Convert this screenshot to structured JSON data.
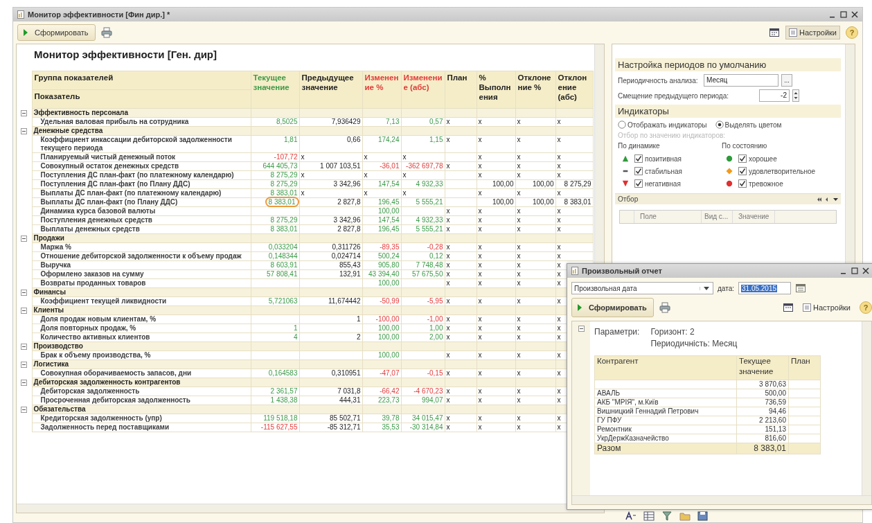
{
  "window": {
    "title": "Монитор эффективности [Фин дир.] *"
  },
  "toolbar": {
    "generate_button": "Сформировать",
    "settings_button": "Настройки",
    "help": "?"
  },
  "report": {
    "title": "Монитор эффективности [Ген. дир]",
    "name_headers": [
      "Группа показателей",
      "Показатель"
    ],
    "columns": [
      {
        "label": "Текущее значение",
        "kind": "positive"
      },
      {
        "label": "Предыдущее значение",
        "kind": "plain"
      },
      {
        "label": "Изменение %",
        "kind": "negative"
      },
      {
        "label": "Изменение (абс)",
        "kind": "negative"
      },
      {
        "label": "План",
        "kind": "plain"
      },
      {
        "label": "% Выполнения",
        "kind": "plain"
      },
      {
        "label": "Отклонение %",
        "kind": "plain"
      },
      {
        "label": "Отклонение (абс)",
        "kind": "plain"
      }
    ],
    "groups": [
      {
        "name": "Эффективность персонала",
        "expanded": true,
        "rows": [
          {
            "name": "Удельная валовая прибыль на сотрудника",
            "cells": [
              {
                "text": "8,5025",
                "kind": "positive"
              },
              {
                "text": "7,936429",
                "kind": "plain"
              },
              {
                "text": "7,13",
                "kind": "positive"
              },
              {
                "text": "0,57",
                "kind": "positive"
              },
              {
                "text": "x",
                "kind": "mark"
              },
              {
                "text": "x",
                "kind": "mark"
              },
              {
                "text": "x",
                "kind": "mark"
              },
              {
                "text": "x",
                "kind": "mark"
              }
            ]
          }
        ]
      },
      {
        "name": "Денежные средства",
        "expanded": true,
        "rows": [
          {
            "name": "Коэффициент инкассации дебиторской задолженности текущего периода",
            "cells": [
              {
                "text": "1,81",
                "kind": "positive"
              },
              {
                "text": "0,66",
                "kind": "plain"
              },
              {
                "text": "174,24",
                "kind": "positive"
              },
              {
                "text": "1,15",
                "kind": "positive"
              },
              {
                "text": "x",
                "kind": "mark"
              },
              {
                "text": "x",
                "kind": "mark"
              },
              {
                "text": "x",
                "kind": "mark"
              },
              {
                "text": "x",
                "kind": "mark"
              }
            ]
          },
          {
            "name": "Планируемый чистый денежный поток",
            "cells": [
              {
                "text": "-107,72",
                "kind": "negative"
              },
              {
                "text": "x",
                "kind": "mark"
              },
              {
                "text": "x",
                "kind": "mark"
              },
              {
                "text": "x",
                "kind": "mark"
              },
              null,
              {
                "text": "x",
                "kind": "mark"
              },
              {
                "text": "x",
                "kind": "mark"
              },
              {
                "text": "x",
                "kind": "mark"
              }
            ]
          },
          {
            "name": "Совокупный остаток денежных средств",
            "cells": [
              {
                "text": "644 405,73",
                "kind": "positive"
              },
              {
                "text": "1 007 103,51",
                "kind": "plain"
              },
              {
                "text": "-36,01",
                "kind": "negative"
              },
              {
                "text": "-362 697,78",
                "kind": "negative"
              },
              {
                "text": "x",
                "kind": "mark"
              },
              {
                "text": "x",
                "kind": "mark"
              },
              {
                "text": "x",
                "kind": "mark"
              },
              {
                "text": "x",
                "kind": "mark"
              }
            ]
          },
          {
            "name": "Поступления ДС план-факт (по платежному календарю)",
            "cells": [
              {
                "text": "8 275,29",
                "kind": "positive"
              },
              {
                "text": "x",
                "kind": "mark"
              },
              {
                "text": "x",
                "kind": "mark"
              },
              {
                "text": "x",
                "kind": "mark"
              },
              null,
              {
                "text": "x",
                "kind": "mark"
              },
              {
                "text": "x",
                "kind": "mark"
              },
              {
                "text": "x",
                "kind": "mark"
              }
            ]
          },
          {
            "name": "Поступления ДС план-факт (по Плану ДДС)",
            "cells": [
              {
                "text": "8 275,29",
                "kind": "positive"
              },
              {
                "text": "3 342,96",
                "kind": "plain"
              },
              {
                "text": "147,54",
                "kind": "positive"
              },
              {
                "text": "4 932,33",
                "kind": "positive"
              },
              null,
              {
                "text": "100,00",
                "kind": "plain"
              },
              {
                "text": "100,00",
                "kind": "plain"
              },
              {
                "text": "8 275,29",
                "kind": "plain"
              }
            ]
          },
          {
            "name": "Выплаты ДС план-факт (по платежному календарю)",
            "cells": [
              {
                "text": "8 383,01",
                "kind": "positive"
              },
              {
                "text": "x",
                "kind": "mark"
              },
              {
                "text": "x",
                "kind": "mark"
              },
              {
                "text": "x",
                "kind": "mark"
              },
              null,
              {
                "text": "x",
                "kind": "mark"
              },
              {
                "text": "x",
                "kind": "mark"
              },
              {
                "text": "x",
                "kind": "mark"
              }
            ]
          },
          {
            "name": "Выплаты ДС план-факт (по Плану ДДС)",
            "cells": [
              {
                "text": "8 383,01",
                "kind": "positive",
                "circled": true
              },
              {
                "text": "2 827,8",
                "kind": "plain"
              },
              {
                "text": "196,45",
                "kind": "positive"
              },
              {
                "text": "5 555,21",
                "kind": "positive"
              },
              null,
              {
                "text": "100,00",
                "kind": "plain"
              },
              {
                "text": "100,00",
                "kind": "plain"
              },
              {
                "text": "8 383,01",
                "kind": "plain"
              }
            ]
          },
          {
            "name": "Динамика курса базовой валюты",
            "cells": [
              null,
              null,
              {
                "text": "100,00",
                "kind": "positive"
              },
              null,
              {
                "text": "x",
                "kind": "mark"
              },
              {
                "text": "x",
                "kind": "mark"
              },
              {
                "text": "x",
                "kind": "mark"
              },
              {
                "text": "x",
                "kind": "mark"
              }
            ]
          },
          {
            "name": "Поступления денежных средств",
            "cells": [
              {
                "text": "8 275,29",
                "kind": "positive"
              },
              {
                "text": "3 342,96",
                "kind": "plain"
              },
              {
                "text": "147,54",
                "kind": "positive"
              },
              {
                "text": "4 932,33",
                "kind": "positive"
              },
              {
                "text": "x",
                "kind": "mark"
              },
              {
                "text": "x",
                "kind": "mark"
              },
              {
                "text": "x",
                "kind": "mark"
              },
              {
                "text": "x",
                "kind": "mark"
              }
            ]
          },
          {
            "name": "Выплаты денежных средств",
            "cells": [
              {
                "text": "8 383,01",
                "kind": "positive"
              },
              {
                "text": "2 827,8",
                "kind": "plain"
              },
              {
                "text": "196,45",
                "kind": "positive"
              },
              {
                "text": "5 555,21",
                "kind": "positive"
              },
              {
                "text": "x",
                "kind": "mark"
              },
              {
                "text": "x",
                "kind": "mark"
              },
              {
                "text": "x",
                "kind": "mark"
              },
              {
                "text": "x",
                "kind": "mark"
              }
            ]
          }
        ]
      },
      {
        "name": "Продажи",
        "expanded": true,
        "rows": [
          {
            "name": "Маржа %",
            "cells": [
              {
                "text": "0,033204",
                "kind": "positive"
              },
              {
                "text": "0,311726",
                "kind": "plain"
              },
              {
                "text": "-89,35",
                "kind": "negative"
              },
              {
                "text": "-0,28",
                "kind": "negative"
              },
              {
                "text": "x",
                "kind": "mark"
              },
              {
                "text": "x",
                "kind": "mark"
              },
              {
                "text": "x",
                "kind": "mark"
              },
              {
                "text": "x",
                "kind": "mark"
              }
            ]
          },
          {
            "name": "Отношение дебиторской задолженности к объему продаж",
            "cells": [
              {
                "text": "0,148344",
                "kind": "positive"
              },
              {
                "text": "0,024714",
                "kind": "plain"
              },
              {
                "text": "500,24",
                "kind": "positive"
              },
              {
                "text": "0,12",
                "kind": "positive"
              },
              {
                "text": "x",
                "kind": "mark"
              },
              {
                "text": "x",
                "kind": "mark"
              },
              {
                "text": "x",
                "kind": "mark"
              },
              {
                "text": "x",
                "kind": "mark"
              }
            ]
          },
          {
            "name": "Выручка",
            "cells": [
              {
                "text": "8 603,91",
                "kind": "positive"
              },
              {
                "text": "855,43",
                "kind": "plain"
              },
              {
                "text": "905,80",
                "kind": "positive"
              },
              {
                "text": "7 748,48",
                "kind": "positive"
              },
              {
                "text": "x",
                "kind": "mark"
              },
              {
                "text": "x",
                "kind": "mark"
              },
              {
                "text": "x",
                "kind": "mark"
              },
              {
                "text": "x",
                "kind": "mark"
              }
            ]
          },
          {
            "name": "Оформлено заказов на сумму",
            "cells": [
              {
                "text": "57 808,41",
                "kind": "positive"
              },
              {
                "text": "132,91",
                "kind": "plain"
              },
              {
                "text": "43 394,40",
                "kind": "positive"
              },
              {
                "text": "57 675,50",
                "kind": "positive"
              },
              {
                "text": "x",
                "kind": "mark"
              },
              {
                "text": "x",
                "kind": "mark"
              },
              {
                "text": "x",
                "kind": "mark"
              },
              {
                "text": "x",
                "kind": "mark"
              }
            ]
          },
          {
            "name": "Возвраты проданных товаров",
            "cells": [
              null,
              null,
              {
                "text": "100,00",
                "kind": "positive"
              },
              null,
              {
                "text": "x",
                "kind": "mark"
              },
              {
                "text": "x",
                "kind": "mark"
              },
              {
                "text": "x",
                "kind": "mark"
              },
              {
                "text": "x",
                "kind": "mark"
              }
            ]
          }
        ]
      },
      {
        "name": "Финансы",
        "expanded": true,
        "rows": [
          {
            "name": "Коэффициент текущей ликвидности",
            "cells": [
              {
                "text": "5,721063",
                "kind": "positive"
              },
              {
                "text": "11,674442",
                "kind": "plain"
              },
              {
                "text": "-50,99",
                "kind": "negative"
              },
              {
                "text": "-5,95",
                "kind": "negative"
              },
              {
                "text": "x",
                "kind": "mark"
              },
              {
                "text": "x",
                "kind": "mark"
              },
              {
                "text": "x",
                "kind": "mark"
              },
              {
                "text": "x",
                "kind": "mark"
              }
            ]
          }
        ]
      },
      {
        "name": "Клиенты",
        "expanded": true,
        "rows": [
          {
            "name": "Доля продаж новым клиентам, %",
            "cells": [
              null,
              {
                "text": "1",
                "kind": "plain"
              },
              {
                "text": "-100,00",
                "kind": "negative"
              },
              {
                "text": "-1,00",
                "kind": "negative"
              },
              {
                "text": "x",
                "kind": "mark"
              },
              {
                "text": "x",
                "kind": "mark"
              },
              {
                "text": "x",
                "kind": "mark"
              },
              {
                "text": "x",
                "kind": "mark"
              }
            ]
          },
          {
            "name": "Доля повторных продаж, %",
            "cells": [
              {
                "text": "1",
                "kind": "positive"
              },
              null,
              {
                "text": "100,00",
                "kind": "positive"
              },
              {
                "text": "1,00",
                "kind": "positive"
              },
              {
                "text": "x",
                "kind": "mark"
              },
              {
                "text": "x",
                "kind": "mark"
              },
              {
                "text": "x",
                "kind": "mark"
              },
              {
                "text": "x",
                "kind": "mark"
              }
            ]
          },
          {
            "name": "Количество активных клиентов",
            "cells": [
              {
                "text": "4",
                "kind": "positive"
              },
              {
                "text": "2",
                "kind": "plain"
              },
              {
                "text": "100,00",
                "kind": "positive"
              },
              {
                "text": "2,00",
                "kind": "positive"
              },
              {
                "text": "x",
                "kind": "mark"
              },
              {
                "text": "x",
                "kind": "mark"
              },
              {
                "text": "x",
                "kind": "mark"
              },
              {
                "text": "x",
                "kind": "mark"
              }
            ]
          }
        ]
      },
      {
        "name": "Производство",
        "expanded": true,
        "rows": [
          {
            "name": "Брак к объему производства, %",
            "cells": [
              null,
              null,
              {
                "text": "100,00",
                "kind": "positive"
              },
              null,
              {
                "text": "x",
                "kind": "mark"
              },
              {
                "text": "x",
                "kind": "mark"
              },
              {
                "text": "x",
                "kind": "mark"
              },
              {
                "text": "x",
                "kind": "mark"
              }
            ]
          }
        ]
      },
      {
        "name": "Логистика",
        "expanded": true,
        "rows": [
          {
            "name": "Совокупная оборачиваемость запасов, дни",
            "cells": [
              {
                "text": "0,164583",
                "kind": "positive"
              },
              {
                "text": "0,310951",
                "kind": "plain"
              },
              {
                "text": "-47,07",
                "kind": "negative"
              },
              {
                "text": "-0,15",
                "kind": "negative"
              },
              {
                "text": "x",
                "kind": "mark"
              },
              {
                "text": "x",
                "kind": "mark"
              },
              {
                "text": "x",
                "kind": "mark"
              },
              {
                "text": "x",
                "kind": "mark"
              }
            ]
          }
        ]
      },
      {
        "name": "Дебиторская задолженность контрагентов",
        "expanded": true,
        "rows": [
          {
            "name": "Дебиторская задолженность",
            "cells": [
              {
                "text": "2 361,57",
                "kind": "positive"
              },
              {
                "text": "7 031,8",
                "kind": "plain"
              },
              {
                "text": "-66,42",
                "kind": "negative"
              },
              {
                "text": "-4 670,23",
                "kind": "negative"
              },
              {
                "text": "x",
                "kind": "mark"
              },
              {
                "text": "x",
                "kind": "mark"
              },
              {
                "text": "x",
                "kind": "mark"
              },
              {
                "text": "x",
                "kind": "mark"
              }
            ]
          },
          {
            "name": "Просроченная дебиторская задолженность",
            "cells": [
              {
                "text": "1 438,38",
                "kind": "positive"
              },
              {
                "text": "444,31",
                "kind": "plain"
              },
              {
                "text": "223,73",
                "kind": "positive"
              },
              {
                "text": "994,07",
                "kind": "positive"
              },
              {
                "text": "x",
                "kind": "mark"
              },
              {
                "text": "x",
                "kind": "mark"
              },
              {
                "text": "x",
                "kind": "mark"
              },
              {
                "text": "x",
                "kind": "mark"
              }
            ]
          }
        ]
      },
      {
        "name": "Обязательства",
        "expanded": true,
        "rows": [
          {
            "name": "Кредиторская задолженность (упр)",
            "cells": [
              {
                "text": "119 518,18",
                "kind": "positive"
              },
              {
                "text": "85 502,71",
                "kind": "plain"
              },
              {
                "text": "39,78",
                "kind": "positive"
              },
              {
                "text": "34 015,47",
                "kind": "positive"
              },
              {
                "text": "x",
                "kind": "mark"
              },
              {
                "text": "x",
                "kind": "mark"
              },
              {
                "text": "x",
                "kind": "mark"
              },
              {
                "text": "x",
                "kind": "mark"
              }
            ]
          },
          {
            "name": "Задолженность перед поставщиками",
            "cells": [
              {
                "text": "-115 627,55",
                "kind": "negative"
              },
              {
                "text": "-85 312,71",
                "kind": "plain"
              },
              {
                "text": "35,53",
                "kind": "positive"
              },
              {
                "text": "-30 314,84",
                "kind": "positive"
              },
              {
                "text": "x",
                "kind": "mark"
              },
              {
                "text": "x",
                "kind": "mark"
              },
              {
                "text": "x",
                "kind": "mark"
              },
              {
                "text": "x",
                "kind": "mark"
              }
            ]
          }
        ]
      }
    ]
  },
  "settings": {
    "period_section": "Настройка периодов по умолчанию",
    "periodicity": {
      "label": "Периодичность анализа:",
      "value": "Месяц",
      "button": "..."
    },
    "offset": {
      "label": "Смещение предыдущего периода:",
      "value": "-2"
    },
    "indicators_section": "Индикаторы",
    "display_modes": [
      {
        "label": "Отображать индикаторы",
        "selected": false
      },
      {
        "label": "Выделять цветом",
        "selected": true
      }
    ],
    "filter_hint": "Отбор по значению индикаторов:",
    "dynamics": {
      "title": "По динамике",
      "items": [
        {
          "label": "позитивная",
          "kind": "up",
          "color": "#2f9a3c",
          "checked": true
        },
        {
          "label": "стабильная",
          "kind": "flat",
          "color": "#555555",
          "checked": true
        },
        {
          "label": "негативная",
          "kind": "down",
          "color": "#e0302f",
          "checked": true
        }
      ]
    },
    "states": {
      "title": "По состоянию",
      "items": [
        {
          "label": "хорошее",
          "kind": "dot",
          "color": "#2f9a3c",
          "checked": true
        },
        {
          "label": "удовлетворительное",
          "kind": "diamond",
          "color": "#f39a1e",
          "checked": true
        },
        {
          "label": "тревожное",
          "kind": "dot",
          "color": "#e0302f",
          "checked": true
        }
      ]
    },
    "filter": {
      "title": "Отбор",
      "columns": [
        "Поле",
        "Вид с...",
        "Значение"
      ]
    }
  },
  "popup": {
    "title": "Произвольный отчет",
    "period_select": "Произвольная дата",
    "date_label": "дата:",
    "date_value": "31.05.2015",
    "generate_button": "Сформировать",
    "settings_button": "Настройки",
    "help": "?",
    "params_label": "Параметри:",
    "params": [
      "Горизонт: 2",
      "Периодичність: Месяц"
    ],
    "columns": [
      "Контрагент",
      "Текущее значение",
      "План"
    ],
    "rows": [
      {
        "value": "3 870,63"
      },
      {
        "name": "АВАЛЬ",
        "value": "500,00"
      },
      {
        "name": "АКБ \"МРІЯ\", м.Київ",
        "value": "736,59"
      },
      {
        "name": "Вишницкий Геннадий Петрович",
        "value": "94,46"
      },
      {
        "name": "ГУ ПФУ",
        "value": "2 213,60"
      },
      {
        "name": "Ремонтник",
        "value": "151,13"
      },
      {
        "name": "УкрДержКазначейство",
        "value": "816,60"
      }
    ],
    "total": {
      "name": "Разом",
      "value": "8 383,01"
    }
  }
}
